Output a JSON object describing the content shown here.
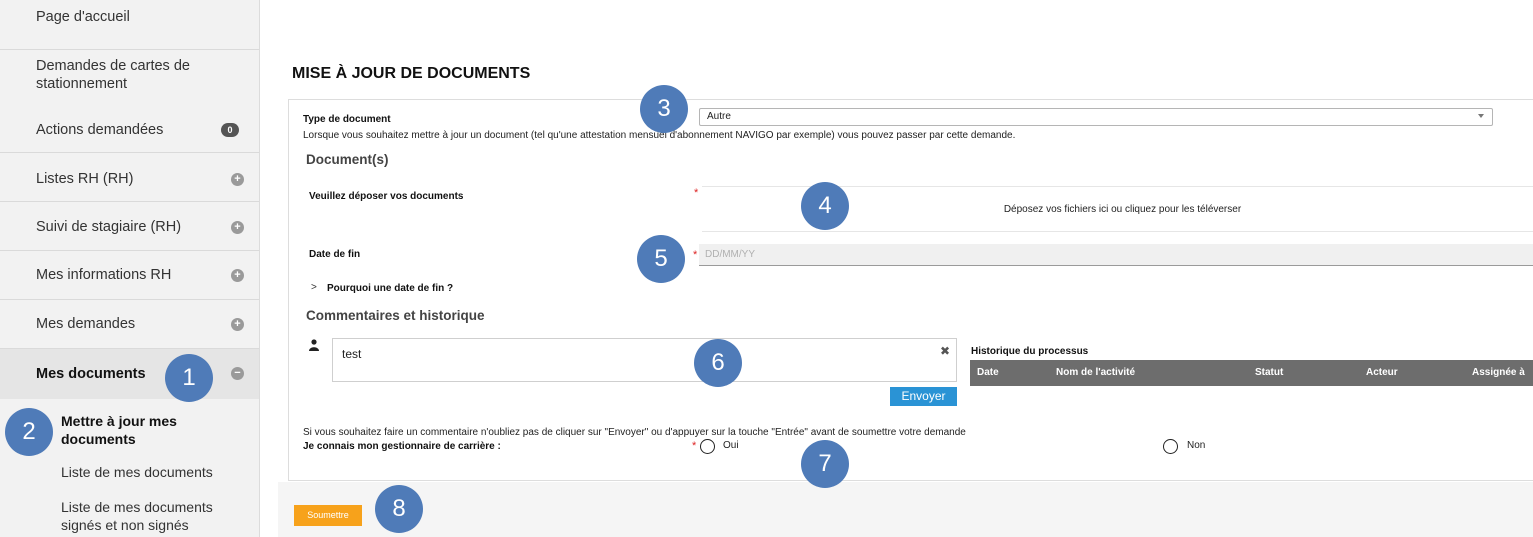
{
  "sidebar": {
    "items": [
      {
        "label": "Page d'accueil"
      },
      {
        "label": "Demandes de cartes de stationnement"
      },
      {
        "label": "Actions demandées",
        "badge": "0"
      },
      {
        "label": "Listes RH (RH)",
        "expand": "+"
      },
      {
        "label": "Suivi de stagiaire (RH)",
        "expand": "+"
      },
      {
        "label": "Mes informations RH",
        "expand": "+"
      },
      {
        "label": "Mes demandes",
        "expand": "+"
      },
      {
        "label": "Mes documents",
        "expand": "−"
      }
    ],
    "sub_items": [
      {
        "label": "Mettre à jour mes documents"
      },
      {
        "label": "Liste de mes documents"
      },
      {
        "label": "Liste de mes documents signés et non signés"
      }
    ]
  },
  "markers": [
    "1",
    "2",
    "3",
    "4",
    "5",
    "6",
    "7",
    "8"
  ],
  "form": {
    "title": "MISE À JOUR DE DOCUMENTS",
    "doc_type_label": "Type de document",
    "doc_type_value": "Autre",
    "doc_type_help": "Lorsque vous souhaitez mettre à jour un document (tel qu'une attestation mensuel d'abonnement NAVIGO par exemple) vous pouvez passer par cette demande.",
    "documents_section": "Document(s)",
    "upload_label": "Veuillez déposer vos documents",
    "upload_text": "Déposez vos fichiers ici ou cliquez pour les téléverser",
    "end_date_label": "Date de fin",
    "end_date_placeholder": "DD/MM/YY",
    "why_end_date": "Pourquoi une date de fin ?",
    "comments_section": "Commentaires et historique",
    "comment_value": "test",
    "send_label": "Envoyer",
    "history_title": "Historique du processus",
    "history_columns": [
      "Date",
      "Nom de l'activité",
      "Statut",
      "Acteur",
      "Assignée à"
    ],
    "comment_note": "Si vous souhaitez faire un commentaire n'oubliez pas de cliquer sur \"Envoyer\" ou d'appuyer sur la touche \"Entrée\" avant de soumettre votre demande",
    "career_label": "Je connais mon gestionnaire de carrière :",
    "radio_yes": "Oui",
    "radio_no": "Non",
    "required_mark": "*",
    "submit_label": "Soumettre"
  },
  "colors": {
    "marker": "#4f7bb8",
    "send_button": "#2a93d5",
    "submit_button": "#f7a21b",
    "history_header": "#6d6d6d",
    "required": "#dd2222"
  }
}
